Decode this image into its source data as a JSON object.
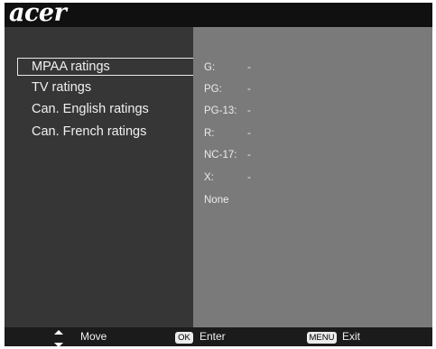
{
  "header": {
    "logo_text": "acer"
  },
  "menu": {
    "items": [
      {
        "label": "MPAA ratings",
        "selected": true
      },
      {
        "label": "TV ratings",
        "selected": false
      },
      {
        "label": "Can. English ratings",
        "selected": false
      },
      {
        "label": "Can. French ratings",
        "selected": false
      }
    ]
  },
  "ratings": [
    {
      "label": "G:",
      "value": "-"
    },
    {
      "label": "PG:",
      "value": "-"
    },
    {
      "label": "PG-13:",
      "value": "-"
    },
    {
      "label": "R:",
      "value": "-"
    },
    {
      "label": "NC-17:",
      "value": "-"
    },
    {
      "label": "X:",
      "value": "-"
    },
    {
      "label": "None",
      "value": ""
    }
  ],
  "footer": {
    "move_label": "Move",
    "ok_key": "OK",
    "enter_label": "Enter",
    "menu_key": "MENU",
    "exit_label": "Exit"
  },
  "colors": {
    "title_bar": "#101010",
    "left_panel": "#363636",
    "right_panel": "#7a7a7a",
    "footer": "#1b1b1b",
    "text": "#f0f0f0"
  }
}
